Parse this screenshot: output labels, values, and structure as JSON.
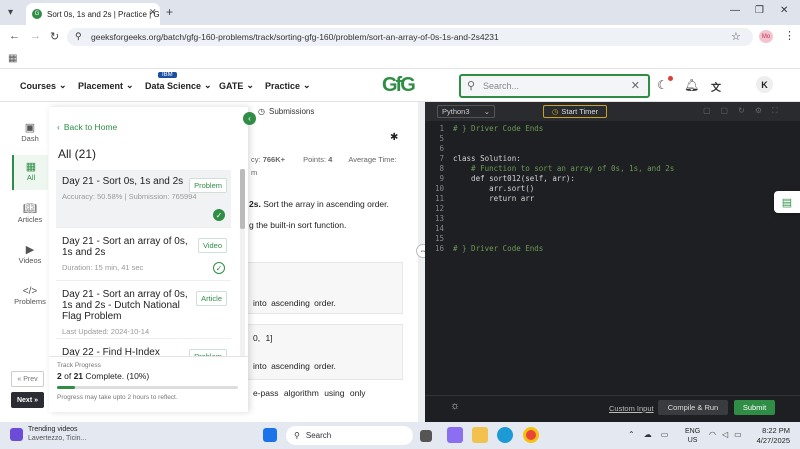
{
  "browser": {
    "tab_title": "Sort 0s, 1s and 2s | Practice | Ge",
    "url": "geeksforgeeks.org/batch/gfg-160-problems/track/sorting-gfg-160/problem/sort-an-array-of-0s-1s-and-2s4231",
    "profile": "Mo"
  },
  "nav": {
    "courses": "Courses",
    "placement": "Placement",
    "data_science": "Data Science",
    "ibm_badge": "IBM",
    "gate": "GATE",
    "practice": "Practice",
    "logo": "GfG",
    "search_placeholder": "Search...",
    "avatar": "K"
  },
  "problem": {
    "submissions_tab": "Submissions",
    "stats": {
      "accuracy_fragment": "cy:",
      "submissions": "766K+",
      "points_label": "Points:",
      "points": "4",
      "avg_time": "Average Time:",
      "avg_time_val": "m"
    },
    "desc_1a": "2s.",
    "desc_1b": "Sort the array in ascending order.",
    "desc_2": "g the built-in sort function.",
    "ex1": "into ascending order.",
    "ex2_arr": "0, 1]",
    "ex2": "into ascending order.",
    "followup": "e-pass algorithm using only"
  },
  "editor": {
    "language": "Python3",
    "timer": "Start Timer",
    "lines": [
      {
        "n": "1",
        "t": "# } Driver Code Ends",
        "cls": "cm"
      },
      {
        "n": "5",
        "t": "",
        "cls": ""
      },
      {
        "n": "6",
        "t": "",
        "cls": ""
      },
      {
        "n": "7",
        "t": "class Solution:",
        "cls": ""
      },
      {
        "n": "8",
        "t": "    # Function to sort an array of 0s, 1s, and 2s",
        "cls": "cm"
      },
      {
        "n": "9",
        "t": "    def sort012(self, arr):",
        "cls": ""
      },
      {
        "n": "10",
        "t": "        arr.sort()",
        "cls": ""
      },
      {
        "n": "11",
        "t": "        return arr",
        "cls": ""
      },
      {
        "n": "12",
        "t": "",
        "cls": ""
      },
      {
        "n": "13",
        "t": "",
        "cls": ""
      },
      {
        "n": "14",
        "t": "",
        "cls": ""
      },
      {
        "n": "15",
        "t": "",
        "cls": ""
      },
      {
        "n": "16",
        "t": "# } Driver Code Ends",
        "cls": "cm"
      }
    ],
    "custom_input": "Custom Input",
    "compile": "Compile & Run",
    "submit": "Submit"
  },
  "rail": {
    "dash": "Dash",
    "all": "All",
    "articles": "Articles",
    "videos": "Videos",
    "problems": "Problems",
    "prev": "« Prev",
    "next": "Next »"
  },
  "panel": {
    "back": "Back to Home",
    "heading": "All (21)",
    "cards": [
      {
        "title": "Day 21 - Sort 0s, 1s and 2s",
        "sub": "Accuracy: 50.58% | Submission: 765994",
        "tag": "Problem"
      },
      {
        "title": "Day 21 - Sort an array of 0s, 1s and 2s",
        "sub": "Duration: 15 min, 41 sec",
        "tag": "Video"
      },
      {
        "title": "Day 21 - Sort an array of 0s, 1s and 2s - Dutch National Flag Problem",
        "sub": "Last Updated: 2024-10-14",
        "tag": "Article"
      },
      {
        "title": "Day 22 - Find H-Index",
        "sub": "",
        "tag": "Problem"
      }
    ],
    "track_label": "Track Progress",
    "prog_done": "2",
    "prog_of": "of",
    "prog_total": "21",
    "prog_text": "Complete. (10%)",
    "prog_note": "Progress may take upto 2 hours to reflect.",
    "progress_fraction": 0.1
  },
  "taskbar": {
    "weather_title": "Trending videos",
    "weather_sub": "Lavertezzo, Ticin...",
    "search": "Search",
    "lang1": "ENG",
    "lang2": "US",
    "time": "8:22 PM",
    "date": "4/27/2025"
  },
  "colors": {
    "brand": "#2f8d46",
    "editor_bg": "#1e1f22"
  }
}
